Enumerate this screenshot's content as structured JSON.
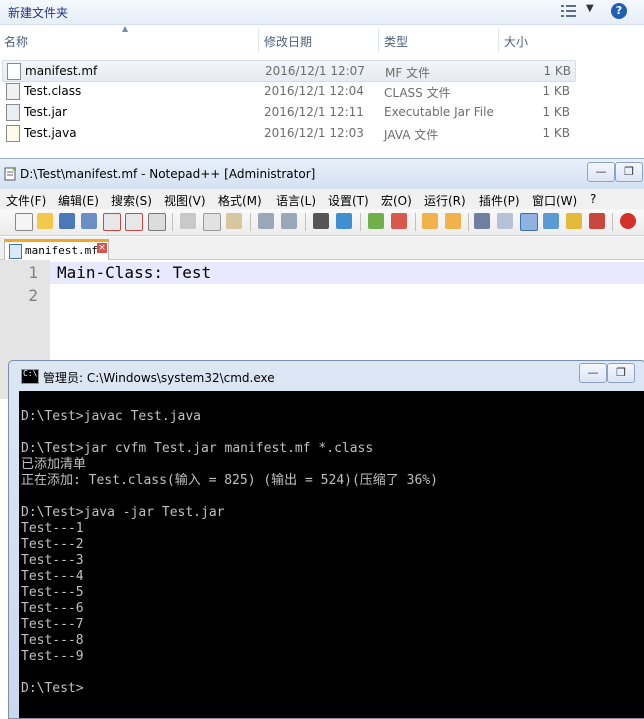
{
  "explorer": {
    "folder_title": "新建文件夹",
    "help_label": "?",
    "columns": {
      "name": "名称",
      "date": "修改日期",
      "type": "类型",
      "size": "大小"
    },
    "files": [
      {
        "name": "manifest.mf",
        "date": "2016/12/1 12:07",
        "type": "MF 文件",
        "size": "1 KB"
      },
      {
        "name": "Test.class",
        "date": "2016/12/1 12:04",
        "type": "CLASS 文件",
        "size": "1 KB"
      },
      {
        "name": "Test.jar",
        "date": "2016/12/1 12:11",
        "type": "Executable Jar File",
        "size": "1 KB"
      },
      {
        "name": "Test.java",
        "date": "2016/12/1 12:03",
        "type": "JAVA 文件",
        "size": "1 KB"
      }
    ]
  },
  "notepad": {
    "title": "D:\\Test\\manifest.mf - Notepad++ [Administrator]",
    "menu": [
      "文件(F)",
      "编辑(E)",
      "搜索(S)",
      "视图(V)",
      "格式(M)",
      "语言(L)",
      "设置(T)",
      "宏(O)",
      "运行(R)",
      "插件(P)",
      "窗口(W)",
      "?"
    ],
    "tab_label": "manifest.mf",
    "line_numbers": [
      "1",
      "2"
    ],
    "lines": [
      "Main-Class: Test",
      ""
    ]
  },
  "cmd": {
    "title": "管理员: C:\\Windows\\system32\\cmd.exe",
    "icon_text": "C:\\",
    "lines": [
      "",
      "D:\\Test>javac Test.java",
      "",
      "D:\\Test>jar cvfm Test.jar manifest.mf *.class",
      "已添加清单",
      "正在添加: Test.class(输入 = 825) (输出 = 524)(压缩了 36%)",
      "",
      "D:\\Test>java -jar Test.jar",
      "Test---1",
      "Test---2",
      "Test---3",
      "Test---4",
      "Test---5",
      "Test---6",
      "Test---7",
      "Test---8",
      "Test---9",
      "",
      "D:\\Test>"
    ]
  },
  "window_buttons": {
    "minimize": "—",
    "restore": "❐"
  },
  "colors": {
    "explorer_title": "#1e3287",
    "cmd_bg": "#000000",
    "cmd_text": "#c0c0c0",
    "npp_current_line": "#e8e8ff"
  }
}
